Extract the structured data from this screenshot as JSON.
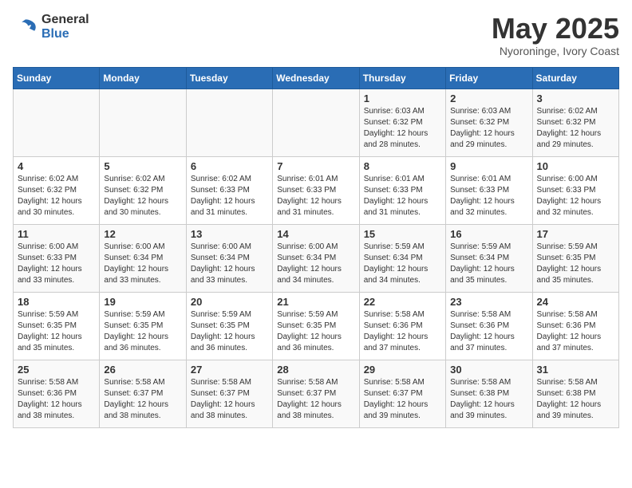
{
  "logo": {
    "general": "General",
    "blue": "Blue"
  },
  "header": {
    "month": "May 2025",
    "location": "Nyoroninge, Ivory Coast"
  },
  "weekdays": [
    "Sunday",
    "Monday",
    "Tuesday",
    "Wednesday",
    "Thursday",
    "Friday",
    "Saturday"
  ],
  "weeks": [
    [
      {
        "day": "",
        "info": ""
      },
      {
        "day": "",
        "info": ""
      },
      {
        "day": "",
        "info": ""
      },
      {
        "day": "",
        "info": ""
      },
      {
        "day": "1",
        "info": "Sunrise: 6:03 AM\nSunset: 6:32 PM\nDaylight: 12 hours\nand 28 minutes."
      },
      {
        "day": "2",
        "info": "Sunrise: 6:03 AM\nSunset: 6:32 PM\nDaylight: 12 hours\nand 29 minutes."
      },
      {
        "day": "3",
        "info": "Sunrise: 6:02 AM\nSunset: 6:32 PM\nDaylight: 12 hours\nand 29 minutes."
      }
    ],
    [
      {
        "day": "4",
        "info": "Sunrise: 6:02 AM\nSunset: 6:32 PM\nDaylight: 12 hours\nand 30 minutes."
      },
      {
        "day": "5",
        "info": "Sunrise: 6:02 AM\nSunset: 6:32 PM\nDaylight: 12 hours\nand 30 minutes."
      },
      {
        "day": "6",
        "info": "Sunrise: 6:02 AM\nSunset: 6:33 PM\nDaylight: 12 hours\nand 31 minutes."
      },
      {
        "day": "7",
        "info": "Sunrise: 6:01 AM\nSunset: 6:33 PM\nDaylight: 12 hours\nand 31 minutes."
      },
      {
        "day": "8",
        "info": "Sunrise: 6:01 AM\nSunset: 6:33 PM\nDaylight: 12 hours\nand 31 minutes."
      },
      {
        "day": "9",
        "info": "Sunrise: 6:01 AM\nSunset: 6:33 PM\nDaylight: 12 hours\nand 32 minutes."
      },
      {
        "day": "10",
        "info": "Sunrise: 6:00 AM\nSunset: 6:33 PM\nDaylight: 12 hours\nand 32 minutes."
      }
    ],
    [
      {
        "day": "11",
        "info": "Sunrise: 6:00 AM\nSunset: 6:33 PM\nDaylight: 12 hours\nand 33 minutes."
      },
      {
        "day": "12",
        "info": "Sunrise: 6:00 AM\nSunset: 6:34 PM\nDaylight: 12 hours\nand 33 minutes."
      },
      {
        "day": "13",
        "info": "Sunrise: 6:00 AM\nSunset: 6:34 PM\nDaylight: 12 hours\nand 33 minutes."
      },
      {
        "day": "14",
        "info": "Sunrise: 6:00 AM\nSunset: 6:34 PM\nDaylight: 12 hours\nand 34 minutes."
      },
      {
        "day": "15",
        "info": "Sunrise: 5:59 AM\nSunset: 6:34 PM\nDaylight: 12 hours\nand 34 minutes."
      },
      {
        "day": "16",
        "info": "Sunrise: 5:59 AM\nSunset: 6:34 PM\nDaylight: 12 hours\nand 35 minutes."
      },
      {
        "day": "17",
        "info": "Sunrise: 5:59 AM\nSunset: 6:35 PM\nDaylight: 12 hours\nand 35 minutes."
      }
    ],
    [
      {
        "day": "18",
        "info": "Sunrise: 5:59 AM\nSunset: 6:35 PM\nDaylight: 12 hours\nand 35 minutes."
      },
      {
        "day": "19",
        "info": "Sunrise: 5:59 AM\nSunset: 6:35 PM\nDaylight: 12 hours\nand 36 minutes."
      },
      {
        "day": "20",
        "info": "Sunrise: 5:59 AM\nSunset: 6:35 PM\nDaylight: 12 hours\nand 36 minutes."
      },
      {
        "day": "21",
        "info": "Sunrise: 5:59 AM\nSunset: 6:35 PM\nDaylight: 12 hours\nand 36 minutes."
      },
      {
        "day": "22",
        "info": "Sunrise: 5:58 AM\nSunset: 6:36 PM\nDaylight: 12 hours\nand 37 minutes."
      },
      {
        "day": "23",
        "info": "Sunrise: 5:58 AM\nSunset: 6:36 PM\nDaylight: 12 hours\nand 37 minutes."
      },
      {
        "day": "24",
        "info": "Sunrise: 5:58 AM\nSunset: 6:36 PM\nDaylight: 12 hours\nand 37 minutes."
      }
    ],
    [
      {
        "day": "25",
        "info": "Sunrise: 5:58 AM\nSunset: 6:36 PM\nDaylight: 12 hours\nand 38 minutes."
      },
      {
        "day": "26",
        "info": "Sunrise: 5:58 AM\nSunset: 6:37 PM\nDaylight: 12 hours\nand 38 minutes."
      },
      {
        "day": "27",
        "info": "Sunrise: 5:58 AM\nSunset: 6:37 PM\nDaylight: 12 hours\nand 38 minutes."
      },
      {
        "day": "28",
        "info": "Sunrise: 5:58 AM\nSunset: 6:37 PM\nDaylight: 12 hours\nand 38 minutes."
      },
      {
        "day": "29",
        "info": "Sunrise: 5:58 AM\nSunset: 6:37 PM\nDaylight: 12 hours\nand 39 minutes."
      },
      {
        "day": "30",
        "info": "Sunrise: 5:58 AM\nSunset: 6:38 PM\nDaylight: 12 hours\nand 39 minutes."
      },
      {
        "day": "31",
        "info": "Sunrise: 5:58 AM\nSunset: 6:38 PM\nDaylight: 12 hours\nand 39 minutes."
      }
    ]
  ]
}
